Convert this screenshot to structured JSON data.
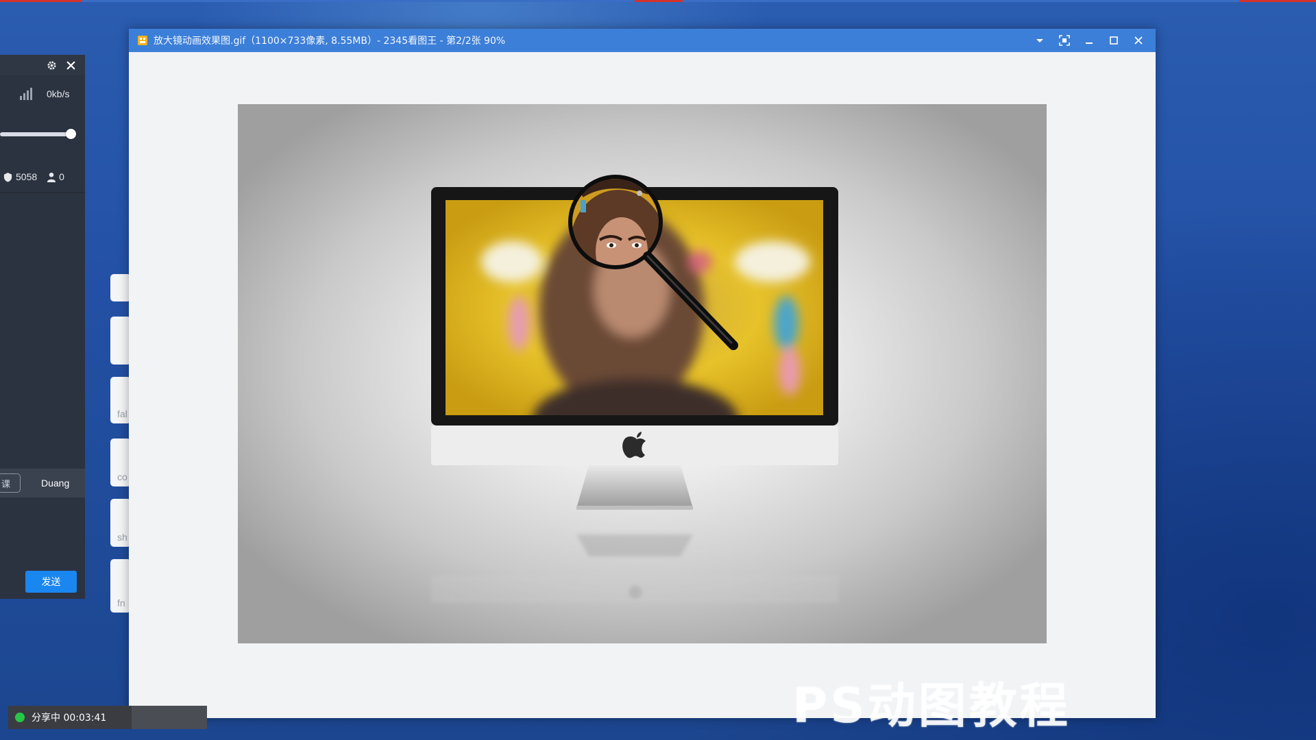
{
  "viewer": {
    "title": "放大镜动画效果图.gif（1100×733像素, 8.55MB）- 2345看图王 - 第2/2张 90%",
    "icons": {
      "app": "image-app-icon",
      "dropdown": "chevron-down-icon",
      "fullscreen": "fullscreen-icon",
      "minimize": "minimize-icon",
      "maximize": "maximize-icon",
      "close": "close-icon"
    },
    "zoom": "90%",
    "image_index": "第2/2张",
    "watermark": "PS动图教程"
  },
  "live_panel": {
    "speed": "0kb/s",
    "volume_level": 0.93,
    "viewers": "5058",
    "members": "0",
    "tab_left": "课",
    "tab_duang": "Duang",
    "send_label": "发送",
    "icons": {
      "settings": "gear-icon",
      "close": "close-icon",
      "signal": "signal-bars-icon",
      "viewers": "user-badge-icon",
      "members": "person-icon"
    }
  },
  "side_cards": [
    "",
    "",
    "fal",
    "co",
    "sh",
    "fn"
  ],
  "share_status": {
    "label": "分享中 00:03:41"
  },
  "colors": {
    "desktop": "#2350a4",
    "titlebar": "#3c7fd8",
    "send_button": "#1a86f0",
    "status_dot": "#26c749",
    "panel": "#2c3340"
  }
}
